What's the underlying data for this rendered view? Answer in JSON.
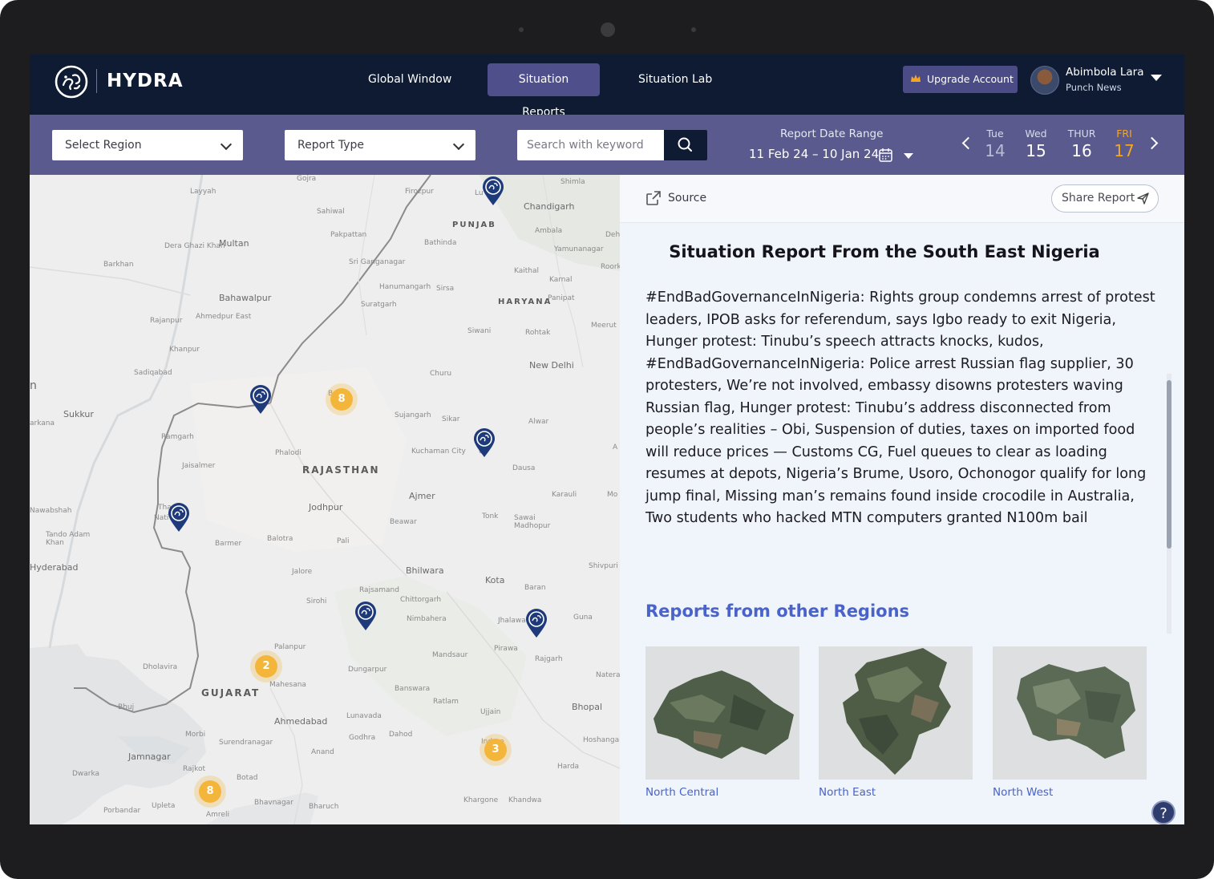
{
  "app": {
    "brand": "HYDRA"
  },
  "nav": {
    "items": [
      {
        "label": "Global Window"
      },
      {
        "label": "Situation Reports"
      },
      {
        "label": "Situation Lab"
      }
    ],
    "active": "Situation Reports",
    "upgrade_label": "Upgrade Account",
    "user_name": "Abimbola Lara",
    "user_org": "Punch News"
  },
  "filters": {
    "region_placeholder": "Select Region",
    "type_placeholder": "Report Type",
    "search_placeholder": "Search with keyword",
    "range_label": "Report Date Range",
    "range_value": "11 Feb 24 – 10 Jan 24",
    "days": [
      {
        "name": "Tue",
        "num": "14"
      },
      {
        "name": "Wed",
        "num": "15"
      },
      {
        "name": "THUR",
        "num": "16"
      },
      {
        "name": "FRI",
        "num": "17"
      }
    ],
    "selected_day": "FRI"
  },
  "map": {
    "clusters": [
      "8",
      "2",
      "3",
      "8"
    ],
    "places": {
      "gojra": "Gojra",
      "firozpur": "Firozpur",
      "ludhiana": "Lu   na",
      "shimla": "Shimla",
      "layyah": "Layyah",
      "sahiwal": "Sahiwal",
      "chandigarh": "Chandigarh",
      "punjab": "PUNJAB",
      "pakpattan": "Pakpattan",
      "ambala": "Ambala",
      "dehra": "Deh",
      "dera_ghazi": "Dera Ghazi Khan",
      "multan": "Multan",
      "bathinda": "Bathinda",
      "yamunanagar": "Yamunanagar",
      "barkhan": "Barkhan",
      "sriganganagar": "Sri Ganganagar",
      "roork": "Roork",
      "kaithal": "Kaithal",
      "karnal": "Karnal",
      "hanumangarh": "Hanumangarh",
      "sirsa": "Sirsa",
      "bahawalpur": "Bahawalpur",
      "panipat": "Panipat",
      "haryana": "HARYANA",
      "suratgarh": "Suratgarh",
      "rajanpur": "Rajanpur",
      "ahmedpur": "Ahmedpur East",
      "meerut": "Meerut",
      "siwani": "Siwani",
      "rohtak": "Rohtak",
      "khanpur": "Khanpur",
      "newdelhi": "New Delhi",
      "sadiqabad": "Sadiqabad",
      "churu": "Churu",
      "sukkur": "Sukkur",
      "arkana": "arkana",
      "bikaner": "B     er",
      "sujangarh": "Sujangarh",
      "sikar": "Sikar",
      "alwar": "Alwar",
      "ramgarh": "Ramgarh",
      "phalodi": "Phalodi",
      "kuchaman": "Kuchaman City",
      "rajasthan": "RAJASTHAN",
      "jaisalmer": "Jaisalmer",
      "dausa": "Dausa",
      "ajmer": "Ajmer",
      "karauli": "Karauli",
      "nawabshah": "Nawabshah",
      "jodhpur": "Jodhpur",
      "tonk": "Tonk",
      "sawai": "Sawai Madhopur",
      "tando": "Tando Adam Khan",
      "beawar": "Beawar",
      "barmer": "Barmer",
      "balotra": "Balotra",
      "pali": "Pali",
      "hyderabad": "Hyderabad",
      "bhilwara": "Bhilwara",
      "shivpuri": "Shivpuri",
      "jalore": "Jalore",
      "kota": "Kota",
      "baran": "Baran",
      "rajsamand": "Rajsamand",
      "sirohi": "Sirohi",
      "chittorgarh": "Chittorgarh",
      "nimbahera": "Nimbahera",
      "jhalawar": "Jhalawa",
      "guna": "Guna",
      "palanpur": "Palanpur",
      "mandsaur": "Mandsaur",
      "pirawa": "Pirawa",
      "rajgarh": "Rajgarh",
      "dholavira": "Dholavira",
      "dungarpur": "Dungarpur",
      "mahesana": "Mahesana",
      "gujarat": "GUJARAT",
      "banswara": "Banswara",
      "naterar": "Naterar",
      "bhuj": "Bhuj",
      "ratlam": "Ratlam",
      "bhopal": "Bhopal",
      "ahmedabad": "Ahmedabad",
      "ujjain": "Ujjain",
      "morbi": "Morbi",
      "surendranagar": "Surendranagar",
      "lunavada": "Lunavada",
      "godhra": "Godhra",
      "dahod": "Dahod",
      "hoshangab": "Hoshangab",
      "jamnagar": "Jamnagar",
      "anand": "Anand",
      "indore": "Indore",
      "dwarka": "Dwarka",
      "rajkot": "Rajkot",
      "harda": "Harda",
      "botad": "Botad",
      "khargone": "Khargone",
      "khandwa": "Khandwa",
      "porbandar": "Porbandar",
      "upleta": "Upleta",
      "bhavnagar": "Bhavnagar",
      "bharuch": "Bharuch",
      "amreli": "Amreli",
      "thar": "Tha    rt",
      "thar2": "Nati   ark",
      "jhunjhunu": "u",
      "n": "n",
      "a": "A",
      "mo": "Mo"
    }
  },
  "report": {
    "source_label": "Source",
    "share_label": "Share Report",
    "title": "Situation Report  From the South East Nigeria",
    "body": "#EndBadGovernanceInNigeria: Rights group condemns arrest of protest leaders, IPOB asks for referendum, says Igbo ready to exit Nigeria, Hunger protest: Tinubu’s speech attracts knocks, kudos, #EndBadGovernanceInNigeria: Police arrest Russian flag supplier, 30 protesters, We’re not involved, embassy disowns protesters waving Russian flag, Hunger protest: Tinubu’s address disconnected from people’s realities – Obi, Suspension of duties, taxes on imported food will reduce prices — Customs CG, Fuel queues to clear as loading resumes at depots, Nigeria’s Brume, Usoro, Ochonogor qualify for long jump final, Missing man’s remains found inside crocodile in Australia, Two students who hacked MTN computers granted N100m bail",
    "other_title": "Reports from other Regions",
    "regions": [
      {
        "name": "North Central"
      },
      {
        "name": "North East"
      },
      {
        "name": "North West"
      }
    ],
    "help": "?"
  },
  "colors": {
    "nav_bg": "#0f1b33",
    "filter_bg": "#5a5a8e",
    "active_tab": "#4f4f8c",
    "accent_link": "#4a63c8",
    "today": "#f5a623",
    "cluster": "#f4b63a",
    "pin": "#1f3a7a"
  }
}
